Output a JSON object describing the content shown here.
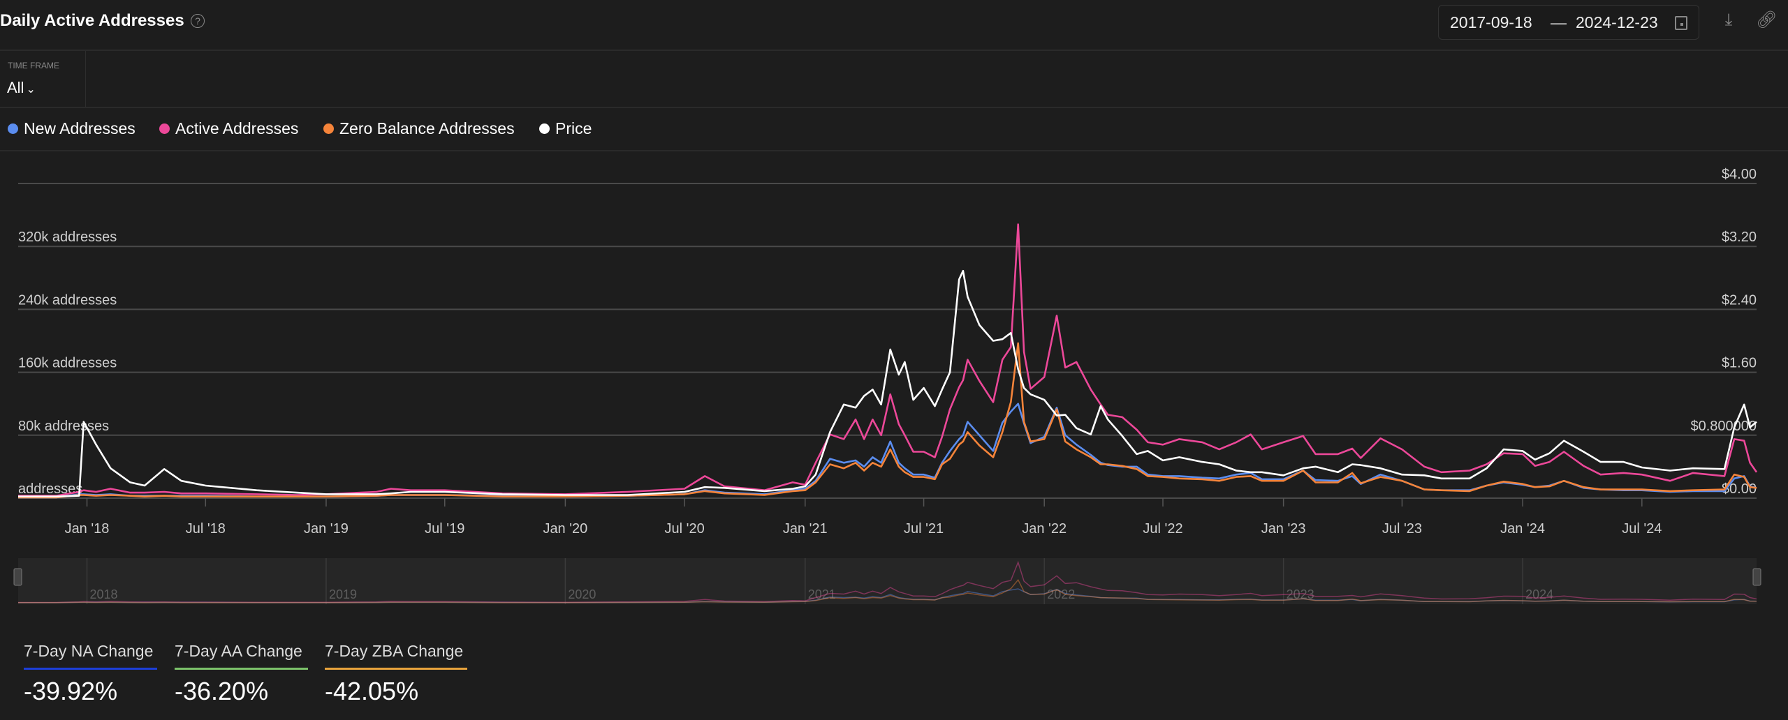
{
  "header": {
    "title": "Daily Active Addresses",
    "help_icon": "question-circle-icon",
    "date_from": "2017-09-18",
    "date_sep": "—",
    "date_to": "2024-12-23",
    "calendar_icon": "calendar-icon",
    "download_icon": "download-icon",
    "link_icon": "link-icon"
  },
  "timeframe": {
    "label": "TIME FRAME",
    "value": "All"
  },
  "legend": [
    {
      "label": "New Addresses",
      "color": "#5b8def"
    },
    {
      "label": "Active Addresses",
      "color": "#ec4899"
    },
    {
      "label": "Zero Balance Addresses",
      "color": "#f5843a"
    },
    {
      "label": "Price",
      "color": "#ffffff"
    }
  ],
  "chart_data": {
    "type": "line",
    "x_range": [
      "2017-09-18",
      "2024-12-23"
    ],
    "y_left": {
      "ticks": [
        0,
        80,
        160,
        240,
        320,
        400
      ],
      "tick_labels": [
        "addresses",
        "80k addresses",
        "160k addresses",
        "240k addresses",
        "320k addresses",
        ""
      ],
      "unit": "thousand addresses",
      "ylim": [
        0,
        400
      ]
    },
    "y_right": {
      "ticks": [
        0,
        0.8,
        1.6,
        2.4,
        3.2,
        4.0
      ],
      "tick_labels": [
        "$0.00",
        "$0.800000",
        "$1.60",
        "$2.40",
        "$3.20",
        "$4.00"
      ],
      "ylim": [
        0,
        4
      ]
    },
    "x_ticks": [
      {
        "date": "2018-01-01",
        "label": "Jan '18"
      },
      {
        "date": "2018-07-01",
        "label": "Jul '18"
      },
      {
        "date": "2019-01-01",
        "label": "Jan '19"
      },
      {
        "date": "2019-07-01",
        "label": "Jul '19"
      },
      {
        "date": "2020-01-01",
        "label": "Jan '20"
      },
      {
        "date": "2020-07-01",
        "label": "Jul '20"
      },
      {
        "date": "2021-01-01",
        "label": "Jan '21"
      },
      {
        "date": "2021-07-01",
        "label": "Jul '21"
      },
      {
        "date": "2022-01-01",
        "label": "Jan '22"
      },
      {
        "date": "2022-07-01",
        "label": "Jul '22"
      },
      {
        "date": "2023-01-01",
        "label": "Jan '23"
      },
      {
        "date": "2023-07-01",
        "label": "Jul '23"
      },
      {
        "date": "2024-01-01",
        "label": "Jan '24"
      },
      {
        "date": "2024-07-01",
        "label": "Jul '24"
      }
    ],
    "navigator_labels": [
      {
        "date": "2018-01-01",
        "label": "2018"
      },
      {
        "date": "2019-01-01",
        "label": "2019"
      },
      {
        "date": "2020-01-01",
        "label": "2020"
      },
      {
        "date": "2021-01-01",
        "label": "2021"
      },
      {
        "date": "2022-01-01",
        "label": "2022"
      },
      {
        "date": "2023-01-01",
        "label": "2023"
      },
      {
        "date": "2024-01-01",
        "label": "2024"
      }
    ],
    "grid": true,
    "x": [
      "2017-09-18",
      "2017-11-15",
      "2017-12-20",
      "2017-12-27",
      "2018-01-15",
      "2018-02-06",
      "2018-03-08",
      "2018-03-30",
      "2018-04-29",
      "2018-05-25",
      "2018-07-01",
      "2018-09-17",
      "2018-11-17",
      "2019-01-01",
      "2019-03-19",
      "2019-04-10",
      "2019-05-10",
      "2019-07-01",
      "2019-09-27",
      "2020-01-01",
      "2020-04-05",
      "2020-07-01",
      "2020-08-01",
      "2020-08-31",
      "2020-10-31",
      "2020-12-13",
      "2021-01-01",
      "2021-01-17",
      "2021-02-08",
      "2021-03-01",
      "2021-03-19",
      "2021-04-01",
      "2021-04-14",
      "2021-04-27",
      "2021-05-11",
      "2021-05-24",
      "2021-06-02",
      "2021-06-15",
      "2021-07-01",
      "2021-07-18",
      "2021-07-29",
      "2021-08-10",
      "2021-08-24",
      "2021-08-30",
      "2021-09-06",
      "2021-09-24",
      "2021-10-15",
      "2021-10-29",
      "2021-11-11",
      "2021-11-22",
      "2021-12-01",
      "2021-12-11",
      "2022-01-01",
      "2022-01-20",
      "2022-02-02",
      "2022-02-19",
      "2022-03-13",
      "2022-03-28",
      "2022-04-08",
      "2022-04-30",
      "2022-05-22",
      "2022-06-08",
      "2022-07-01",
      "2022-07-26",
      "2022-08-30",
      "2022-09-25",
      "2022-10-21",
      "2022-11-12",
      "2022-11-29",
      "2023-01-01",
      "2023-01-31",
      "2023-02-19",
      "2023-03-25",
      "2023-04-16",
      "2023-04-29",
      "2023-05-29",
      "2023-07-01",
      "2023-08-04",
      "2023-08-30",
      "2023-10-12",
      "2023-11-07",
      "2023-12-03",
      "2024-01-01",
      "2024-01-20",
      "2024-02-11",
      "2024-03-04",
      "2024-04-03",
      "2024-04-29",
      "2024-06-03",
      "2024-07-01",
      "2024-08-13",
      "2024-09-17",
      "2024-11-04",
      "2024-11-19",
      "2024-12-04",
      "2024-12-13",
      "2024-12-23"
    ],
    "series": [
      {
        "name": "New Addresses",
        "axis": "left",
        "color": "#5b8def",
        "values": [
          1,
          1,
          5,
          5,
          4,
          5,
          3,
          3,
          3,
          3,
          3,
          2,
          2,
          2,
          3,
          4,
          4,
          4,
          3,
          2,
          3,
          5,
          10,
          7,
          5,
          10,
          12,
          22,
          50,
          45,
          48,
          40,
          52,
          45,
          72,
          45,
          38,
          30,
          30,
          26,
          45,
          60,
          75,
          80,
          97,
          80,
          60,
          96,
          110,
          120,
          95,
          70,
          78,
          115,
          80,
          68,
          55,
          45,
          42,
          40,
          40,
          30,
          28,
          28,
          26,
          25,
          30,
          32,
          24,
          24,
          35,
          23,
          22,
          28,
          18,
          30,
          22,
          11,
          10,
          10,
          16,
          20,
          17,
          14,
          16,
          22,
          13,
          11,
          10,
          10,
          8,
          9,
          9,
          25,
          28,
          15,
          13
        ]
      },
      {
        "name": "Active Addresses",
        "axis": "left",
        "color": "#ec4899",
        "values": [
          3,
          3,
          8,
          10,
          8,
          12,
          7,
          7,
          8,
          6,
          6,
          5,
          4,
          5,
          8,
          12,
          10,
          10,
          6,
          5,
          8,
          12,
          28,
          15,
          10,
          20,
          17,
          45,
          81,
          75,
          100,
          75,
          100,
          80,
          132,
          94,
          80,
          59,
          59,
          52,
          78,
          113,
          141,
          150,
          176,
          149,
          122,
          176,
          192,
          348,
          186,
          139,
          154,
          232,
          166,
          173,
          138,
          119,
          106,
          103,
          87,
          71,
          68,
          75,
          71,
          62,
          71,
          81,
          62,
          71,
          79,
          56,
          56,
          63,
          51,
          76,
          62,
          40,
          33,
          35,
          43,
          57,
          56,
          41,
          46,
          59,
          41,
          30,
          32,
          30,
          22,
          32,
          28,
          75,
          73,
          45,
          33
        ]
      },
      {
        "name": "Zero Balance Addresses",
        "axis": "left",
        "color": "#f5843a",
        "values": [
          1,
          1,
          4,
          4,
          3,
          4,
          3,
          2,
          3,
          2,
          2,
          2,
          2,
          2,
          3,
          4,
          4,
          4,
          2,
          2,
          3,
          5,
          9,
          6,
          4,
          9,
          10,
          20,
          43,
          38,
          45,
          35,
          45,
          40,
          62,
          40,
          33,
          27,
          27,
          24,
          43,
          50,
          68,
          72,
          84,
          67,
          52,
          84,
          122,
          197,
          97,
          72,
          75,
          113,
          72,
          62,
          52,
          43,
          43,
          41,
          37,
          28,
          27,
          25,
          24,
          22,
          27,
          28,
          22,
          22,
          35,
          20,
          20,
          32,
          19,
          27,
          22,
          11,
          10,
          9,
          16,
          21,
          18,
          14,
          15,
          22,
          14,
          11,
          11,
          11,
          9,
          10,
          11,
          30,
          27,
          14,
          13
        ]
      },
      {
        "name": "Price",
        "axis": "right",
        "color": "#ffffff",
        "values": [
          0.02,
          0.02,
          0.03,
          0.97,
          0.68,
          0.38,
          0.2,
          0.16,
          0.37,
          0.22,
          0.16,
          0.1,
          0.07,
          0.05,
          0.05,
          0.06,
          0.08,
          0.08,
          0.05,
          0.04,
          0.04,
          0.08,
          0.14,
          0.13,
          0.09,
          0.12,
          0.15,
          0.3,
          0.84,
          1.19,
          1.15,
          1.3,
          1.38,
          1.19,
          1.89,
          1.57,
          1.73,
          1.25,
          1.4,
          1.17,
          1.38,
          1.6,
          2.78,
          2.89,
          2.56,
          2.2,
          2.0,
          2.02,
          2.1,
          1.64,
          1.4,
          1.32,
          1.25,
          1.05,
          1.06,
          0.89,
          0.81,
          1.17,
          1.0,
          0.79,
          0.56,
          0.6,
          0.48,
          0.52,
          0.46,
          0.43,
          0.35,
          0.33,
          0.33,
          0.29,
          0.38,
          0.4,
          0.33,
          0.43,
          0.42,
          0.38,
          0.3,
          0.29,
          0.25,
          0.25,
          0.38,
          0.62,
          0.6,
          0.49,
          0.57,
          0.73,
          0.59,
          0.46,
          0.46,
          0.39,
          0.35,
          0.38,
          0.37,
          0.9,
          1.19,
          0.9,
          0.97
        ]
      }
    ]
  },
  "stats": [
    {
      "label": "7-Day NA Change",
      "value": "-39.92%",
      "color": "#1d3fd8"
    },
    {
      "label": "7-Day AA Change",
      "value": "-36.20%",
      "color": "#7cc26a"
    },
    {
      "label": "7-Day ZBA Change",
      "value": "-42.05%",
      "color": "#e8a33c"
    }
  ]
}
